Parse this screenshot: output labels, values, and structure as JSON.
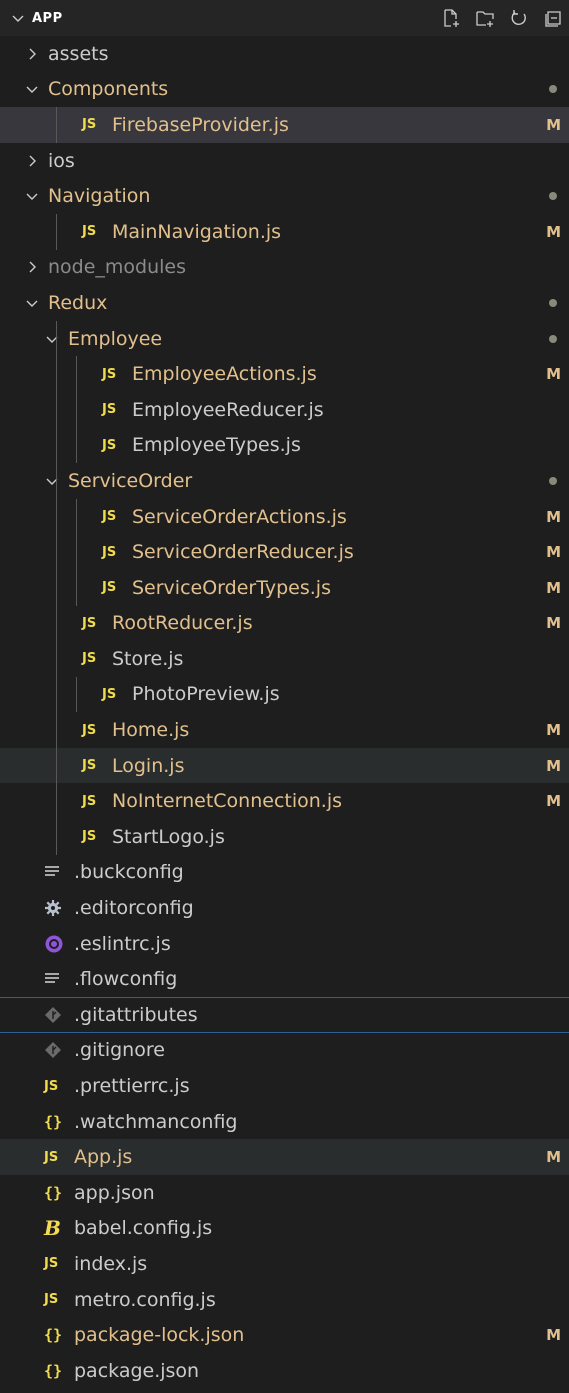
{
  "explorer": {
    "title": "APP"
  },
  "items": [
    {
      "label": "assets",
      "kind": "folder",
      "open": false,
      "depth": 1
    },
    {
      "label": "Components",
      "kind": "folder",
      "open": true,
      "depth": 1,
      "dot": true,
      "modified": true
    },
    {
      "label": "FirebaseProvider.js",
      "kind": "js",
      "depth": 2,
      "badge": "M",
      "modified": true,
      "selected": true
    },
    {
      "label": "ios",
      "kind": "folder",
      "open": false,
      "depth": 1
    },
    {
      "label": "Navigation",
      "kind": "folder",
      "open": true,
      "depth": 1,
      "dot": true,
      "modified": true
    },
    {
      "label": "MainNavigation.js",
      "kind": "js",
      "depth": 2,
      "badge": "M",
      "modified": true
    },
    {
      "label": "node_modules",
      "kind": "folder",
      "open": false,
      "depth": 1,
      "dimmed": true
    },
    {
      "label": "Redux",
      "kind": "folder",
      "open": true,
      "depth": 1,
      "dot": true,
      "modified": true
    },
    {
      "label": "Employee",
      "kind": "folder",
      "open": true,
      "depth": 2,
      "dot": true,
      "modified": true
    },
    {
      "label": "EmployeeActions.js",
      "kind": "js",
      "depth": 3,
      "badge": "M",
      "modified": true
    },
    {
      "label": "EmployeeReducer.js",
      "kind": "js",
      "depth": 3
    },
    {
      "label": "EmployeeTypes.js",
      "kind": "js",
      "depth": 3
    },
    {
      "label": "ServiceOrder",
      "kind": "folder",
      "open": true,
      "depth": 2,
      "dot": true,
      "modified": true
    },
    {
      "label": "ServiceOrderActions.js",
      "kind": "js",
      "depth": 3,
      "badge": "M",
      "modified": true
    },
    {
      "label": "ServiceOrderReducer.js",
      "kind": "js",
      "depth": 3,
      "badge": "M",
      "modified": true
    },
    {
      "label": "ServiceOrderTypes.js",
      "kind": "js",
      "depth": 3,
      "badge": "M",
      "modified": true
    },
    {
      "label": "RootReducer.js",
      "kind": "js",
      "depth": 2,
      "badge": "M",
      "modified": true
    },
    {
      "label": "Store.js",
      "kind": "js",
      "depth": 2
    },
    {
      "label": "PhotoPreview.js",
      "kind": "js",
      "depth": 3
    },
    {
      "label": "Home.js",
      "kind": "js",
      "depth": 2,
      "badge": "M",
      "modified": true
    },
    {
      "label": "Login.js",
      "kind": "js",
      "depth": 2,
      "badge": "M",
      "modified": true,
      "hover": true
    },
    {
      "label": "NoInternetConnection.js",
      "kind": "js",
      "depth": 2,
      "badge": "M",
      "modified": true
    },
    {
      "label": "StartLogo.js",
      "kind": "js",
      "depth": 2
    },
    {
      "label": ".buckconfig",
      "kind": "lines",
      "depth": 1
    },
    {
      "label": ".editorconfig",
      "kind": "gear",
      "depth": 1
    },
    {
      "label": ".eslintrc.js",
      "kind": "eslint",
      "depth": 1
    },
    {
      "label": ".flowconfig",
      "kind": "lines",
      "depth": 1
    },
    {
      "label": ".gitattributes",
      "kind": "git",
      "depth": 1,
      "focused": true
    },
    {
      "label": ".gitignore",
      "kind": "git",
      "depth": 1
    },
    {
      "label": ".prettierrc.js",
      "kind": "js",
      "depth": 1
    },
    {
      "label": ".watchmanconfig",
      "kind": "json",
      "depth": 1
    },
    {
      "label": "App.js",
      "kind": "js",
      "depth": 1,
      "badge": "M",
      "modified": true,
      "hover": true
    },
    {
      "label": "app.json",
      "kind": "json",
      "depth": 1
    },
    {
      "label": "babel.config.js",
      "kind": "babel",
      "depth": 1
    },
    {
      "label": "index.js",
      "kind": "js",
      "depth": 1
    },
    {
      "label": "metro.config.js",
      "kind": "js",
      "depth": 1
    },
    {
      "label": "package-lock.json",
      "kind": "json",
      "depth": 1,
      "badge": "M",
      "modified": true
    },
    {
      "label": "package.json",
      "kind": "json",
      "depth": 1
    }
  ]
}
